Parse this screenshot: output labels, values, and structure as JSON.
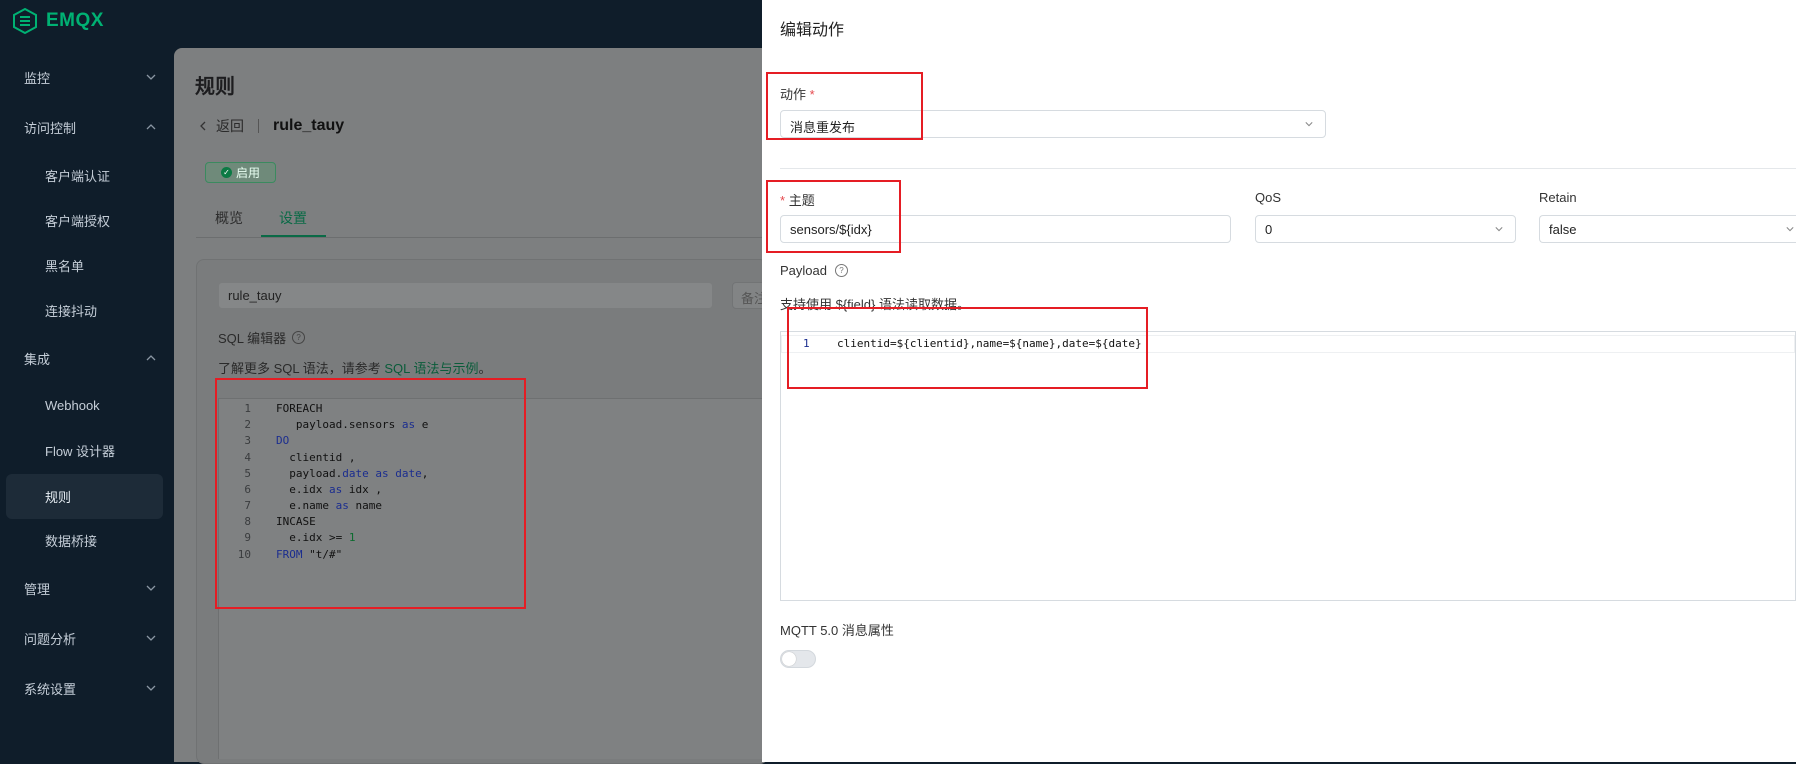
{
  "app": {
    "brand": "EMQX"
  },
  "sidebar": {
    "items": [
      {
        "label": "监控"
      },
      {
        "label": "访问控制"
      },
      {
        "label": "客户端认证"
      },
      {
        "label": "客户端授权"
      },
      {
        "label": "黑名单"
      },
      {
        "label": "连接抖动"
      },
      {
        "label": "集成"
      },
      {
        "label": "Webhook"
      },
      {
        "label": "Flow 设计器"
      },
      {
        "label": "规则"
      },
      {
        "label": "数据桥接"
      },
      {
        "label": "管理"
      },
      {
        "label": "问题分析"
      },
      {
        "label": "系统设置"
      }
    ]
  },
  "page": {
    "title": "规则",
    "back_label": "返回",
    "rule_name": "rule_tauy",
    "status": "启用",
    "tabs": [
      {
        "label": "概览"
      },
      {
        "label": "设置"
      }
    ],
    "name_value": "rule_tauy",
    "note_placeholder": "备注",
    "sql_label": "SQL 编辑器",
    "sql_help_prefix": "了解更多 SQL 语法，请参考 ",
    "sql_help_link": "SQL 语法与示例",
    "sql_help_suffix": "。"
  },
  "sql": {
    "line_numbers": [
      "1",
      "2",
      "3",
      "4",
      "5",
      "6",
      "7",
      "8",
      "9",
      "10"
    ]
  },
  "drawer": {
    "title": "编辑动作",
    "action_label": "动作",
    "action_value": "消息重发布",
    "topic_label": "主题",
    "topic_value": "sensors/${idx}",
    "qos_label": "QoS",
    "qos_value": "0",
    "retain_label": "Retain",
    "retain_value": "false",
    "payload_label": "Payload",
    "payload_help": "支持使用 ${field} 语法读取数据。",
    "payload_line_no": "1",
    "payload_value": "clientid=${clientid},name=${name},date=${date}",
    "mqtt_label": "MQTT 5.0 消息属性"
  },
  "colors": {
    "accent": "#00b173",
    "highlight": "#e51d24"
  }
}
